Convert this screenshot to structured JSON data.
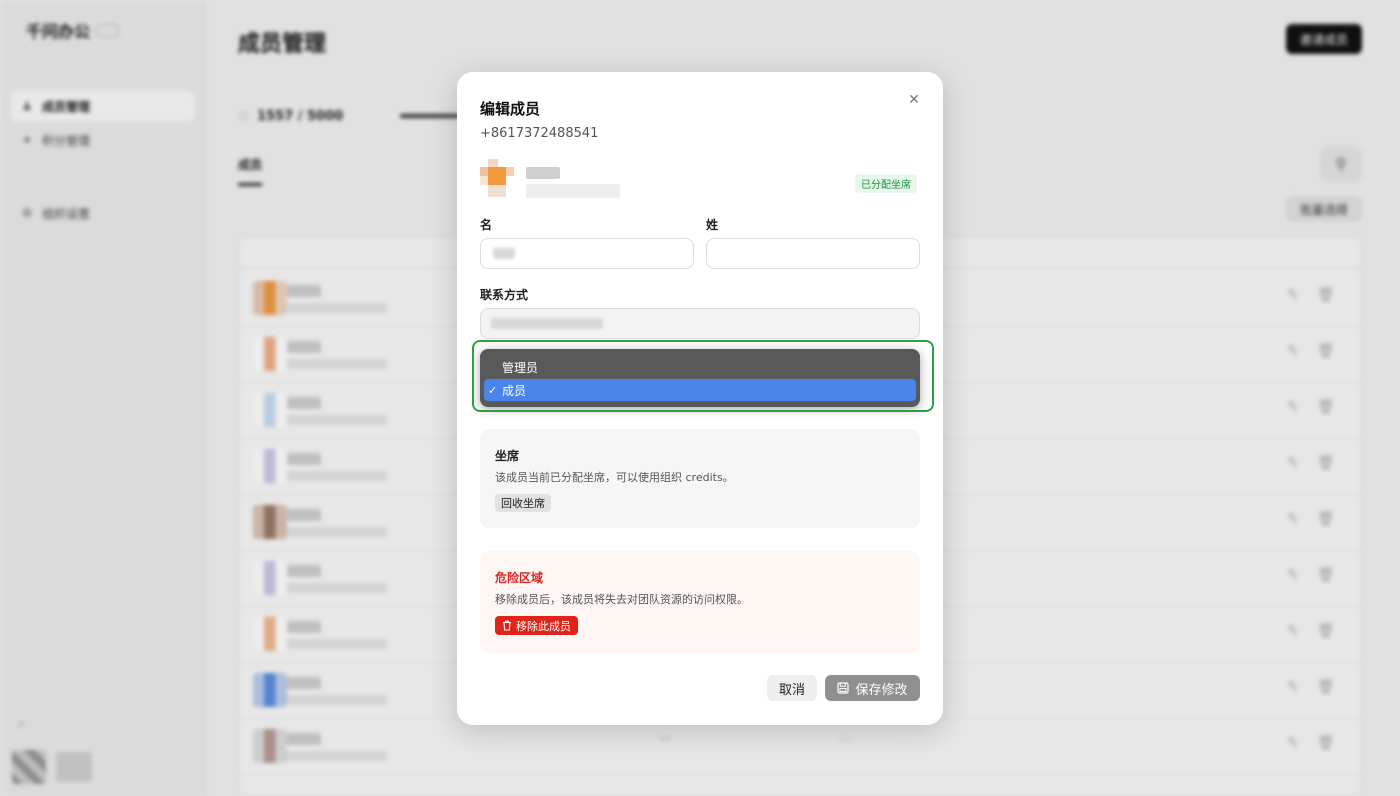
{
  "colors": {
    "accent_dark": "#111111",
    "seat_badge_text": "#1b8f3a",
    "seat_badge_bg": "#e8f7ec",
    "danger": "#d62828",
    "danger_button": "#e0241b",
    "dropdown_selected": "#4a86ea",
    "highlight_border": "#2ea043"
  },
  "background": {
    "brand": "千问办公",
    "sidebar": {
      "items": [
        {
          "label": "成员管理",
          "icon": "users-icon",
          "active": true
        },
        {
          "label": "积分管理",
          "icon": "sparkle-icon",
          "active": false
        },
        {
          "label": "组织设置",
          "icon": "gear-icon",
          "active": false
        }
      ]
    },
    "page_title": "成员管理",
    "invite_button": "邀请成员",
    "seats_used": "1557 / 5000",
    "tabs": [
      "成员"
    ],
    "bulk_button": "批量选择"
  },
  "modal": {
    "title": "编辑成员",
    "phone": "+8617372488541",
    "seat_badge": "已分配坐席",
    "first_name_label": "名",
    "last_name_label": "姓",
    "contact_label": "联系方式",
    "role_dropdown": {
      "options": [
        {
          "label": "管理员",
          "selected": false
        },
        {
          "label": "成员",
          "selected": true
        }
      ],
      "check_mark": "✓"
    },
    "seat_section": {
      "title": "坐席",
      "description": "该成员当前已分配坐席，可以使用组织 credits。",
      "reclaim_button": "回收坐席"
    },
    "danger_section": {
      "title": "危险区域",
      "description": "移除成员后，该成员将失去对团队资源的访问权限。",
      "remove_button": "移除此成员"
    },
    "cancel_button": "取消",
    "save_button": "保存修改"
  }
}
